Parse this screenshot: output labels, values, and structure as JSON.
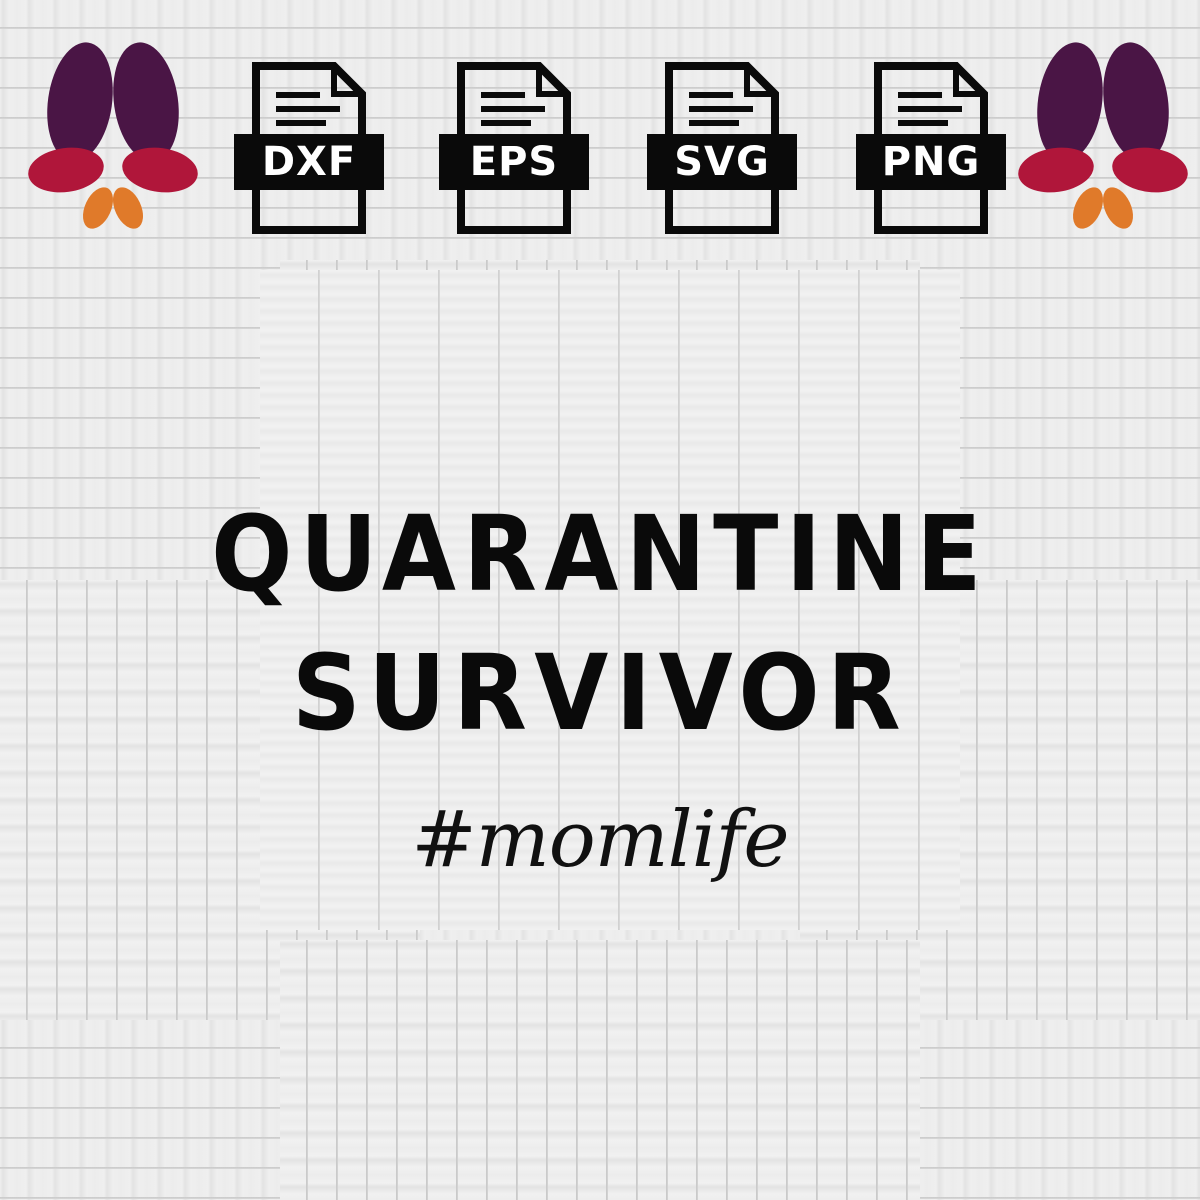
{
  "colors": {
    "background": "#ececec",
    "icon_fill": "#0a0a0a",
    "icon_label": "#ffffff",
    "butterfly_top": "#4a1545",
    "butterfly_mid": "#b0163a",
    "butterfly_bottom": "#e07a2a",
    "text": "#0a0a0a"
  },
  "file_formats": [
    {
      "label": "DXF",
      "icon": "document-icon"
    },
    {
      "label": "EPS",
      "icon": "document-icon"
    },
    {
      "label": "SVG",
      "icon": "document-icon"
    },
    {
      "label": "PNG",
      "icon": "document-icon"
    }
  ],
  "logo": {
    "icon": "butterfly-icon"
  },
  "design": {
    "line1": "QUARANTINE",
    "line2": "SURVIVOR",
    "hashtag": "#momlife"
  }
}
